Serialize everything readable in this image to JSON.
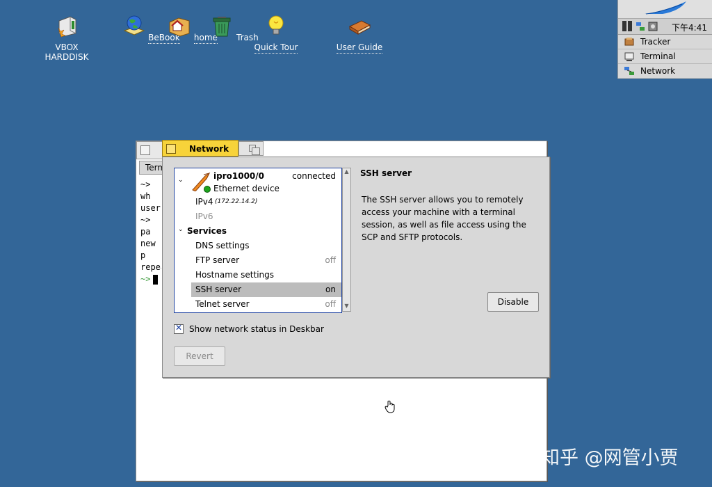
{
  "desktop": {
    "icons": [
      {
        "label": "VBOX HARDDISK",
        "underline": false
      },
      {
        "label": "BeBook",
        "underline": true
      },
      {
        "label": "home",
        "underline": true
      },
      {
        "label": "Trash",
        "underline": false
      },
      {
        "label": "Quick Tour",
        "underline": true
      },
      {
        "label": "User Guide",
        "underline": true
      }
    ]
  },
  "deskbar": {
    "clock": "下午4:41",
    "items": [
      {
        "label": "Tracker",
        "icon": "tracker-icon"
      },
      {
        "label": "Terminal",
        "icon": "terminal-icon"
      },
      {
        "label": "Network",
        "icon": "network-icon"
      }
    ]
  },
  "terminal": {
    "tab_label": "Terminal",
    "lines": [
      "~> wh",
      "user",
      "~> pa",
      "new p",
      "repea",
      "~>"
    ]
  },
  "network_window": {
    "title": "Network",
    "device": {
      "name": "ipro1000/0",
      "status": "connected",
      "type": "Ethernet device"
    },
    "ipv4": {
      "label": "IPv4",
      "address": "(172.22.14.2)"
    },
    "ipv6": {
      "label": "IPv6"
    },
    "services_header": "Services",
    "services": [
      {
        "label": "DNS settings",
        "value": ""
      },
      {
        "label": "FTP server",
        "value": "off"
      },
      {
        "label": "Hostname settings",
        "value": ""
      },
      {
        "label": "SSH server",
        "value": "on",
        "selected": true
      },
      {
        "label": "Telnet server",
        "value": "off"
      }
    ],
    "detail": {
      "title": "SSH server",
      "description": "The SSH server allows you to remotely access your machine with a terminal session, as well as file access using the SCP and SFTP protocols.",
      "button": "Disable"
    },
    "show_status_label": "Show network status in Deskbar",
    "show_status_checked": true,
    "revert_label": "Revert"
  },
  "watermark": "知乎 @网管小贾"
}
